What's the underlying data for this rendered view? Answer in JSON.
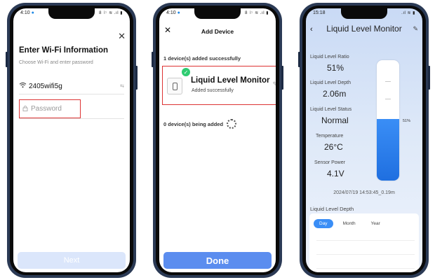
{
  "phone1": {
    "status_time": "4:10",
    "status_right": "8 ⚐ ≋ .ıl ▮",
    "title": "Enter Wi-Fi Information",
    "subtitle": "Choose Wi-Fi and enter password",
    "wifi_name": "2405wifi5g",
    "switch_icon": "⇆",
    "password_placeholder": "Password",
    "next_label": "Next"
  },
  "phone2": {
    "status_time": "4:10",
    "status_right": "8 ⚐ ≋ .ıl ▮",
    "header": "Add Device",
    "added_text": "1 device(s) added successfully",
    "device_name": "Liquid Level Monitor",
    "device_status": "Added successfully",
    "adding_text": "0 device(s) being added",
    "done_label": "Done"
  },
  "phone3": {
    "status_time": "15:18",
    "status_right": ".ıl ≋ ▮",
    "header": "Liquid Level Monitor",
    "stats": [
      {
        "label": "Liquid Level Ratio",
        "value": "51%"
      },
      {
        "label": "Liquid Level Depth",
        "value": "2.06m"
      },
      {
        "label": "Liquid Level Status",
        "value": "Normal"
      },
      {
        "label": "Temperature",
        "value": "26°C"
      },
      {
        "label": "Sensor Power",
        "value": "4.1V"
      }
    ],
    "tank_fill_fraction": 0.51,
    "tank_label": "51%",
    "timestamp": "2024/07/19 14:53:45_0.19m",
    "chart_title": "Liquid Level Depth",
    "tabs": [
      "Day",
      "Month",
      "Year"
    ],
    "active_tab": "Day"
  },
  "colors": {
    "accent_blue": "#3a8ef6",
    "highlight_red": "#dd3333",
    "success_green": "#2ecc71",
    "phone_frame": "#2b3a55"
  }
}
